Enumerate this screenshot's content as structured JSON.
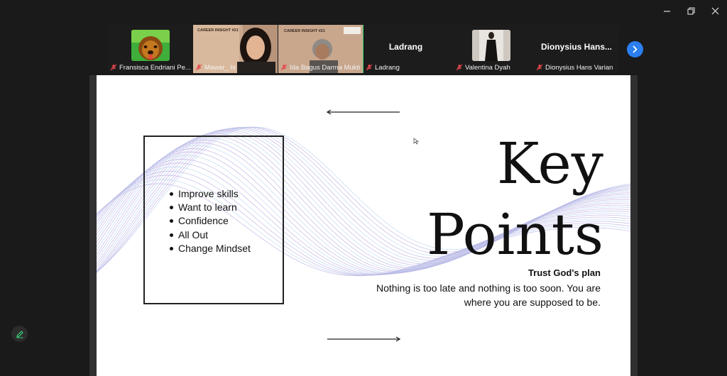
{
  "participants": [
    {
      "name": "Fransisca Endriani Pe...",
      "kind": "avatar",
      "muted": true
    },
    {
      "name": "Mawar_ Is",
      "kind": "video",
      "muted": true
    },
    {
      "name": "Ida Bagus Darma Mukti ...",
      "kind": "video",
      "muted": true,
      "active": true,
      "overlay_text": "CAREER INSIGHT #21"
    },
    {
      "name": "Ladrang",
      "kind": "name-only",
      "display_name": "Ladrang",
      "muted": true
    },
    {
      "name": "Valentina Dyah",
      "kind": "avatar",
      "muted": true
    },
    {
      "name": "Dionysius Hans Varian",
      "kind": "name-only",
      "display_name": "Dionysius  Hans...",
      "muted": true
    }
  ],
  "mawar_overlay": "CAREER INSIGHT #21",
  "slide": {
    "bullets": [
      "Improve skills",
      "Want to learn",
      "Confidence",
      "All Out",
      "Change Mindset"
    ],
    "title_line1": "Key",
    "title_line2": "Points",
    "subtitle": "Trust God's plan",
    "quote": "Nothing is too late and nothing is too soon. You are where you are supposed to be."
  },
  "colors": {
    "background": "#1a1a1a",
    "active_speaker": "#2fd36b",
    "next_button": "#2b7ff0",
    "muted_mic": "#e5484d",
    "wave_purple": "#b9aee3",
    "wave_blue": "#b8d3ee"
  },
  "icons": {
    "minimize": "minimize-icon",
    "restore": "restore-icon",
    "close": "close-icon",
    "next": "chevron-right-icon",
    "annotate": "pencil-icon",
    "muted": "mic-muted-icon"
  }
}
